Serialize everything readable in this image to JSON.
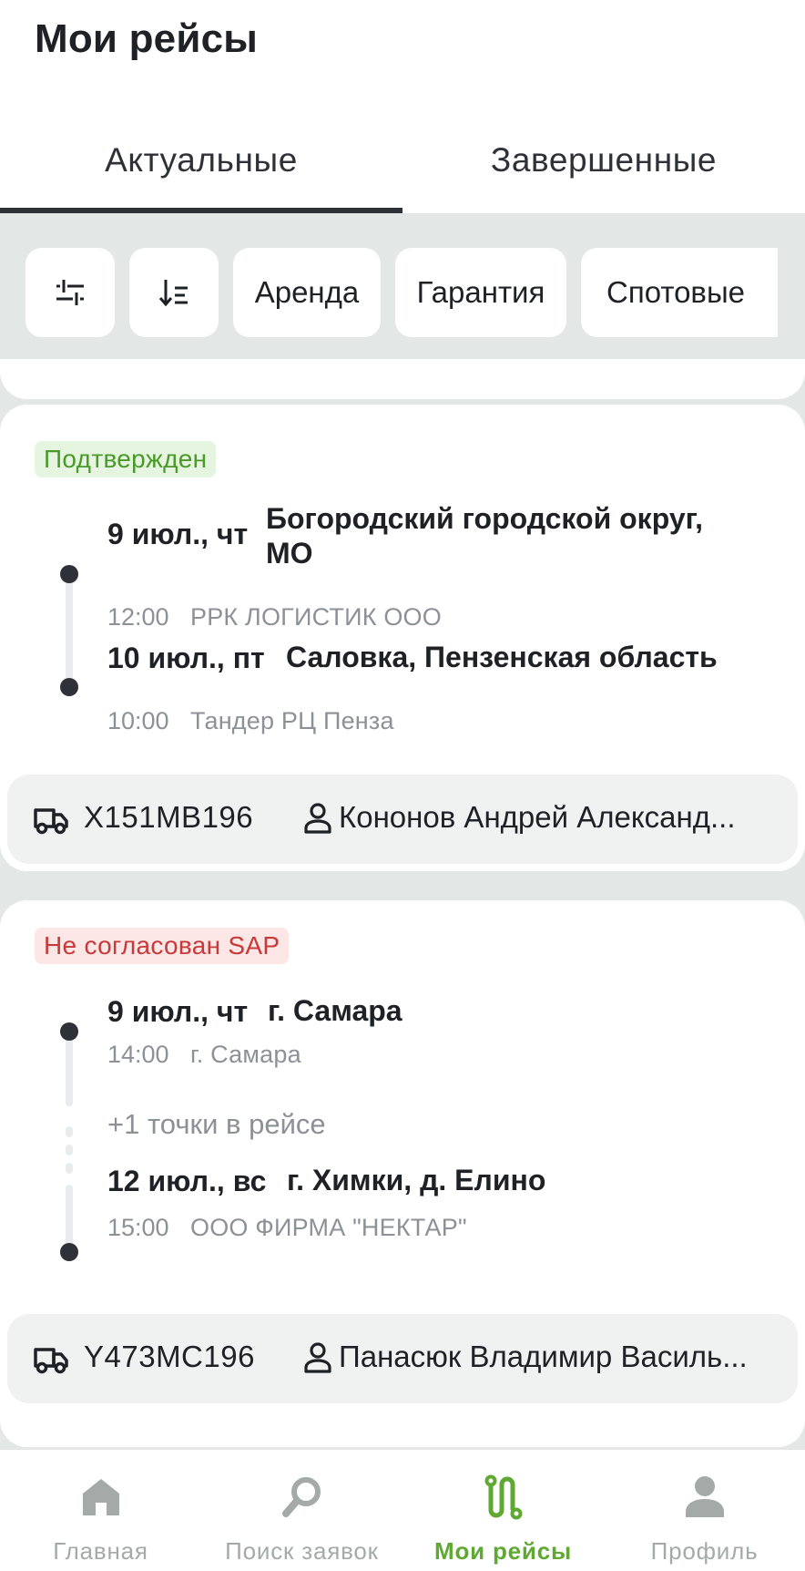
{
  "header": {
    "title": "Мои рейсы"
  },
  "tabs": [
    {
      "label": "Актуальные",
      "active": true
    },
    {
      "label": "Завершенные",
      "active": false
    }
  ],
  "filters": {
    "icon_buttons": [
      "filter-sliders-icon",
      "sort-icon"
    ],
    "chips": [
      "Аренда",
      "Гарантия",
      "Спотовые"
    ]
  },
  "trips": [
    {
      "status": "Подтвержден",
      "status_color": "#4a9a2a",
      "stops": [
        {
          "date": "9 июл., чт",
          "place": "Богородский городской округ, МО",
          "time": "12:00",
          "org": "РРК ЛОГИСТИК ООО"
        },
        {
          "date": "10 июл., пт",
          "place": "Саловка, Пензенская область",
          "time": "10:00",
          "org": "Тандер РЦ Пенза"
        }
      ],
      "vehicle": "Х151МВ196",
      "driver": "Кононов Андрей Александ..."
    },
    {
      "status": "Не согласован SAP",
      "status_color": "#c73a3a",
      "stops": [
        {
          "date": "9 июл., чт",
          "place": "г. Самара",
          "time": "14:00",
          "org": "г. Самара"
        },
        {
          "date": "12 июл., вс",
          "place": "г. Химки, д. Елино",
          "time": "15:00",
          "org": "ООО ФИРМА \"НЕКТАР\""
        }
      ],
      "extra_points": "+1 точки в рейсе",
      "vehicle": "Y473MC196",
      "driver": "Панасюк Владимир Василь..."
    }
  ],
  "bottom_nav": [
    {
      "label": "Главная",
      "icon": "home-icon",
      "active": false
    },
    {
      "label": "Поиск заявок",
      "icon": "search-icon",
      "active": false
    },
    {
      "label": "Мои рейсы",
      "icon": "route-icon",
      "active": true
    },
    {
      "label": "Профиль",
      "icon": "profile-icon",
      "active": false
    }
  ],
  "colors": {
    "accent": "#5fa832",
    "background": "#e3e8e6",
    "text": "#1e2126",
    "muted": "#8c9197"
  }
}
